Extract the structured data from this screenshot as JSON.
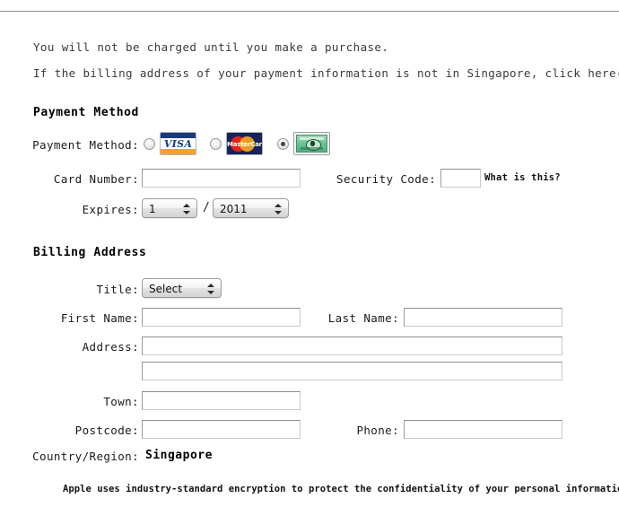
{
  "page": {
    "intro_line_1": "You will not be charged until you make a purchase.",
    "intro_line_2": "If the billing address of your payment information is not in Singapore, click here",
    "footnote": "Apple uses industry-standard encryption to protect the confidentiality of your personal information."
  },
  "payment_method": {
    "heading": "Payment Method",
    "label": "Payment Method:",
    "options": [
      {
        "name": "visa",
        "label": "VISA",
        "selected": false
      },
      {
        "name": "mastercard",
        "label": "MasterCard",
        "selected": false
      },
      {
        "name": "americanexpress",
        "label": "American Express",
        "selected": true
      }
    ],
    "card_number_label": "Card Number:",
    "card_number_value": "",
    "security_code_label": "Security Code:",
    "security_code_value": "",
    "what_is_this": "What is this?",
    "expires_label": "Expires:",
    "expires_month": "1",
    "expires_year": "2011",
    "expires_separator": "/"
  },
  "billing_address": {
    "heading": "Billing Address",
    "title_label": "Title:",
    "title_value": "Select",
    "first_name_label": "First Name:",
    "first_name_value": "",
    "last_name_label": "Last Name:",
    "last_name_value": "",
    "address_label": "Address:",
    "address_line1_value": "",
    "address_line2_value": "",
    "town_label": "Town:",
    "town_value": "",
    "postcode_label": "Postcode:",
    "postcode_value": "",
    "phone_label": "Phone:",
    "phone_value": "",
    "country_label": "Country/Region:",
    "country_value": "Singapore"
  },
  "colors": {
    "visa_blue": "#1a3a7a",
    "visa_gold": "#f2a32c",
    "mastercard_navy": "#16245c",
    "mastercard_red": "#e2231a",
    "mastercard_orange": "#f4a81d",
    "amex_green": "#52b083",
    "rule": "#8a8a8a"
  }
}
